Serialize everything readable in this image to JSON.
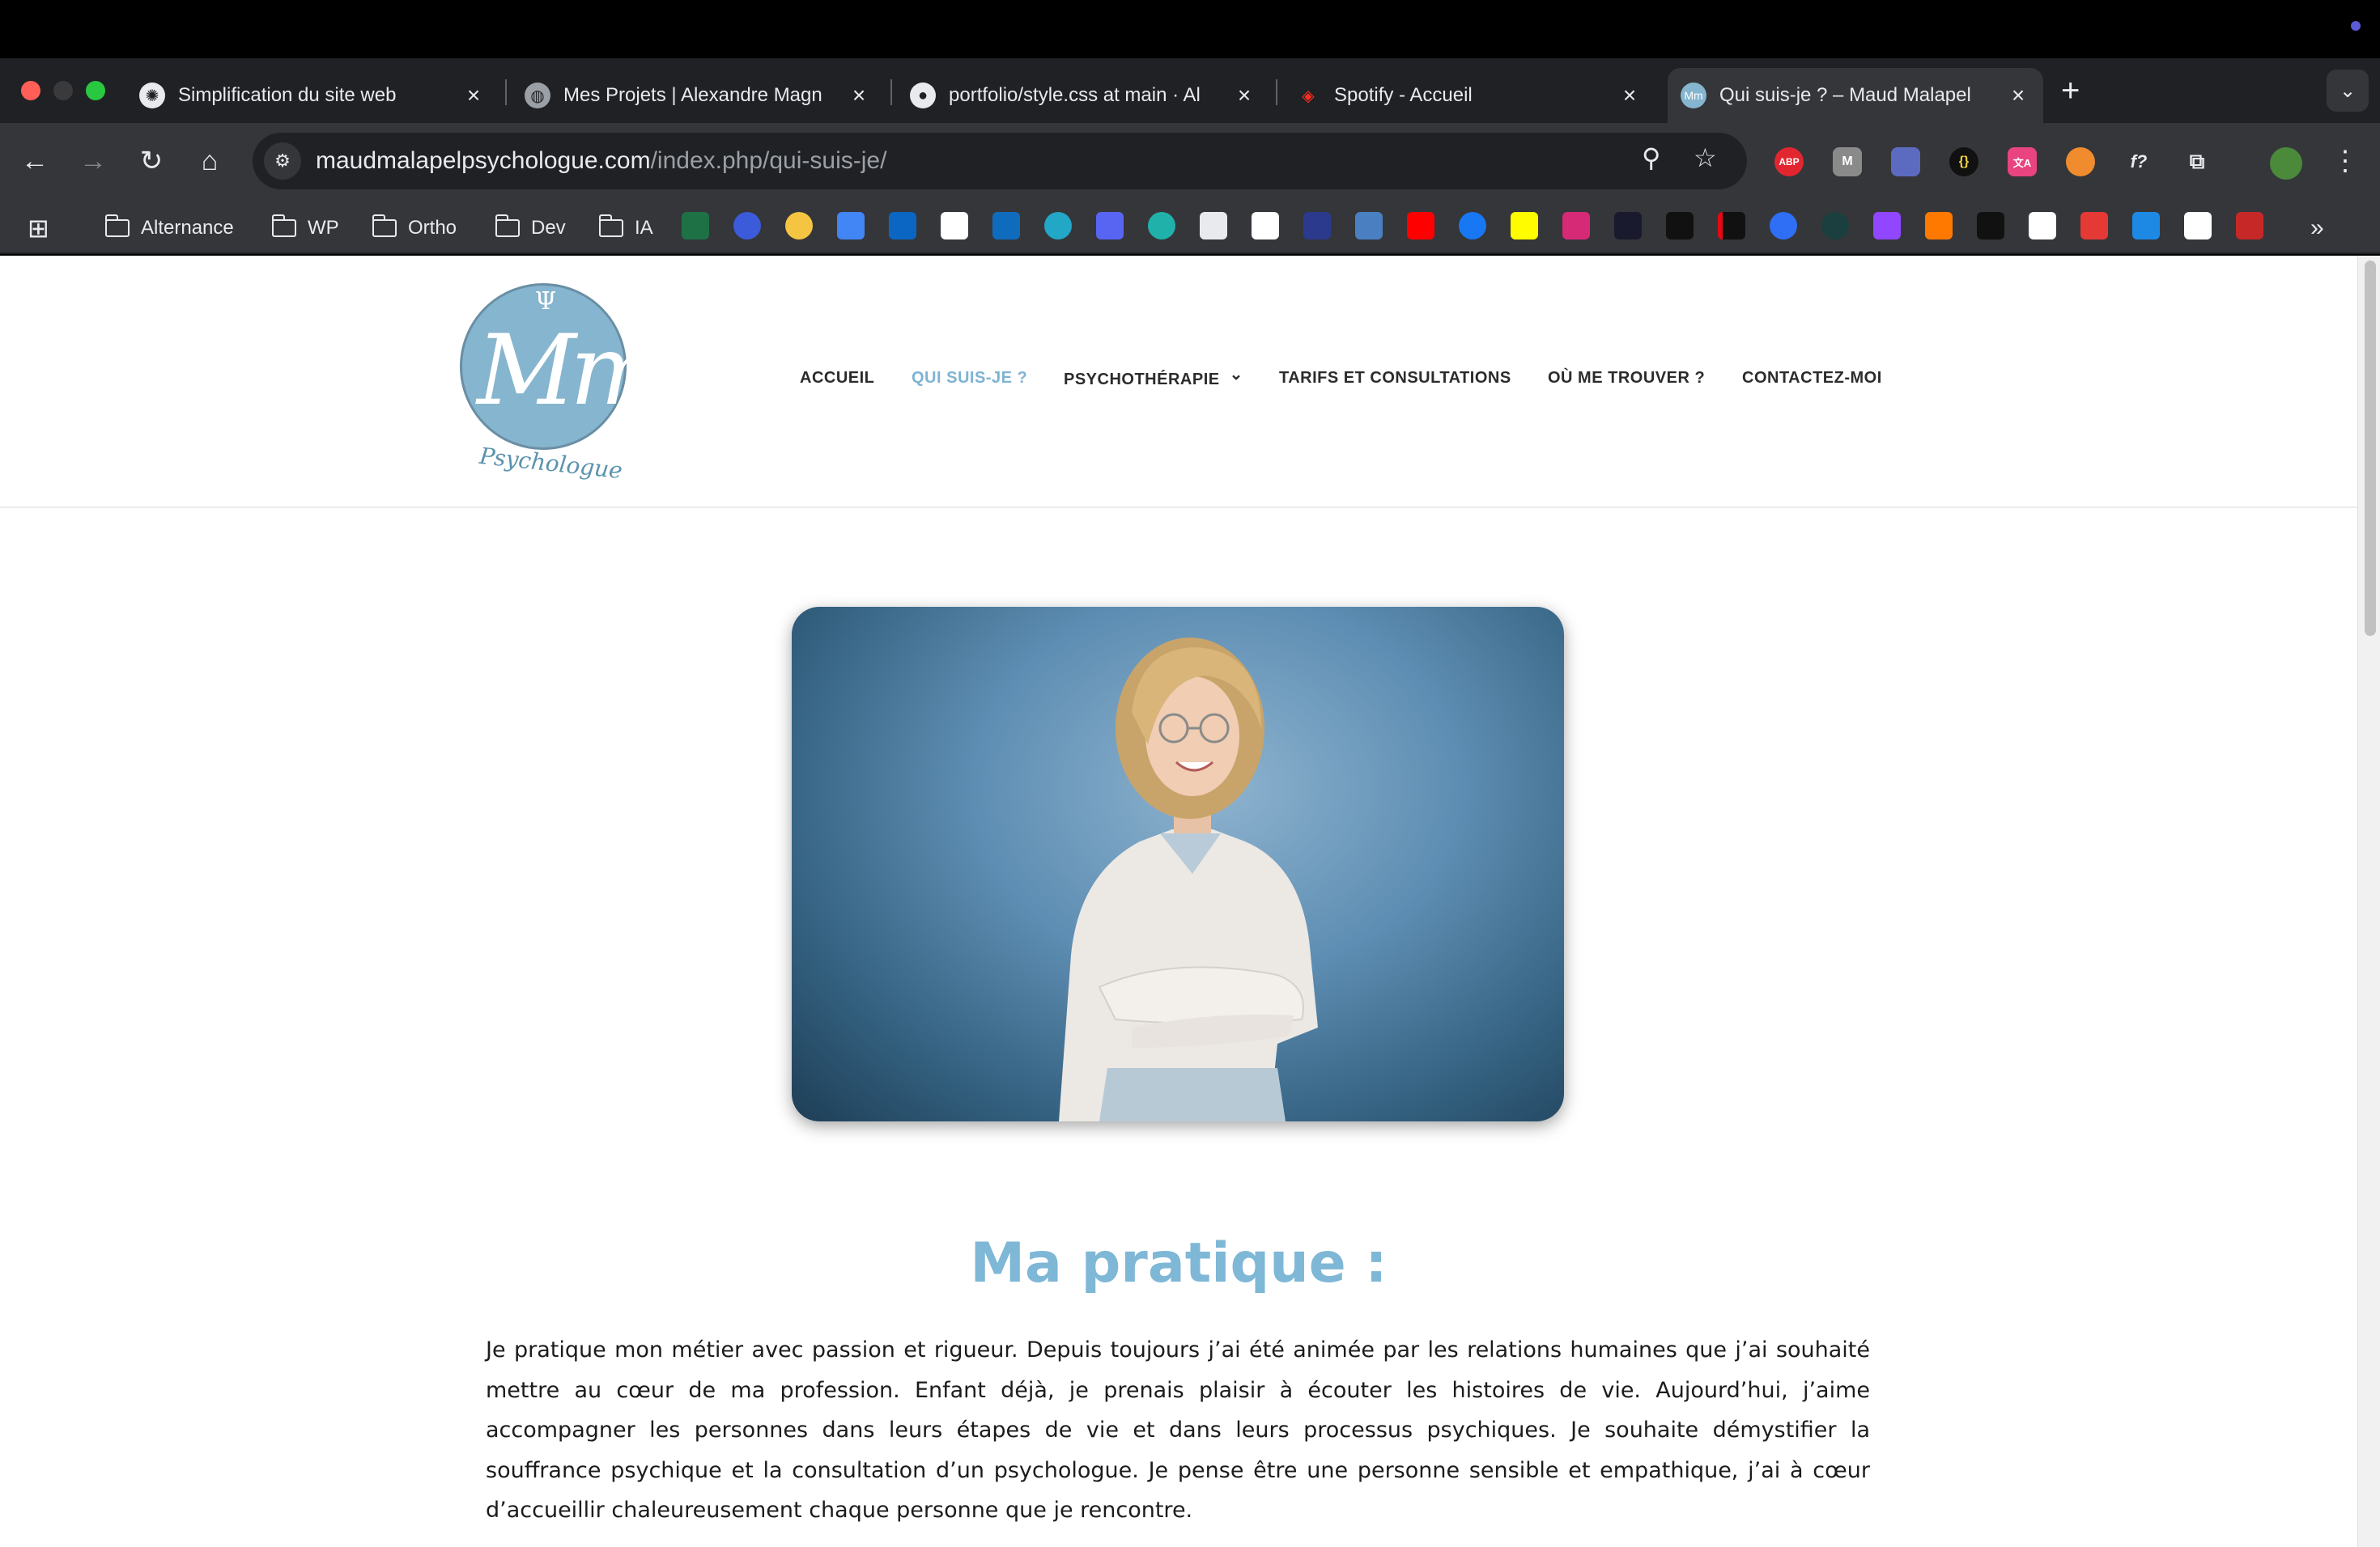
{
  "tabs": [
    {
      "title": "Simplification du site web",
      "favicon": "openai-icon",
      "close": "×"
    },
    {
      "title": "Mes Projets | Alexandre Magn",
      "favicon": "globe-icon",
      "close": "×"
    },
    {
      "title": "portfolio/style.css at main · Al",
      "favicon": "github-icon",
      "close": "×"
    },
    {
      "title": "Spotify - Accueil",
      "favicon": "laravel-icon",
      "close": "×"
    },
    {
      "title": "Qui suis-je ? – Maud Malapel",
      "favicon": "site-logo-icon",
      "close": "×"
    }
  ],
  "new_tab_label": "+",
  "tab_menu_label": "⌄",
  "toolbar": {
    "back": "←",
    "forward": "→",
    "reload": "↻",
    "home": "⌂",
    "url_host": "maudmalapelpsychologue.com",
    "url_path": "/index.php/qui-suis-je/",
    "zoom": "⚲",
    "star": "☆",
    "menu": "⋮"
  },
  "extensions": [
    "ABP",
    "M",
    "{}",
    "文A",
    "f?"
  ],
  "bookmarks": {
    "apps_icon": "⊞",
    "folders": [
      "Alternance",
      "WP",
      "Ortho",
      "Dev",
      "IA"
    ],
    "overflow": "»"
  },
  "site": {
    "logo": {
      "symbol": "Ψ",
      "monogram": "Mm",
      "subtitle": "Psychologue"
    },
    "nav": [
      {
        "label": "ACCUEIL"
      },
      {
        "label": "QUI SUIS-JE ?"
      },
      {
        "label": "PSYCHOTHÉRAPIE",
        "chevron": "⌄"
      },
      {
        "label": "TARIFS ET CONSULTATIONS"
      },
      {
        "label": "OÙ ME TROUVER ?"
      },
      {
        "label": "CONTACTEZ-MOI"
      }
    ],
    "section_title": "Ma pratique :",
    "paragraph": "Je pratique mon métier avec passion et rigueur. Depuis toujours j’ai été animée par les relations humaines que j’ai souhaité mettre au cœur de ma profession. Enfant déjà, je prenais plaisir à écouter les histoires de vie. Aujourd’hui, j’aime accompagner les personnes dans leurs étapes de vie et dans leurs processus psychiques. Je souhaite démystifier la souffrance psychique et la consultation d’un psychologue. Je pense être une personne sensible et empathique, j’ai à cœur d’accueillir chaleureusement chaque personne que je rencontre."
  },
  "colors": {
    "accent": "#7fb7d6",
    "logo": "#86b5cf",
    "nav_text": "#2b2b2b",
    "chrome_dark": "#202124",
    "chrome_mid": "#35363a"
  }
}
